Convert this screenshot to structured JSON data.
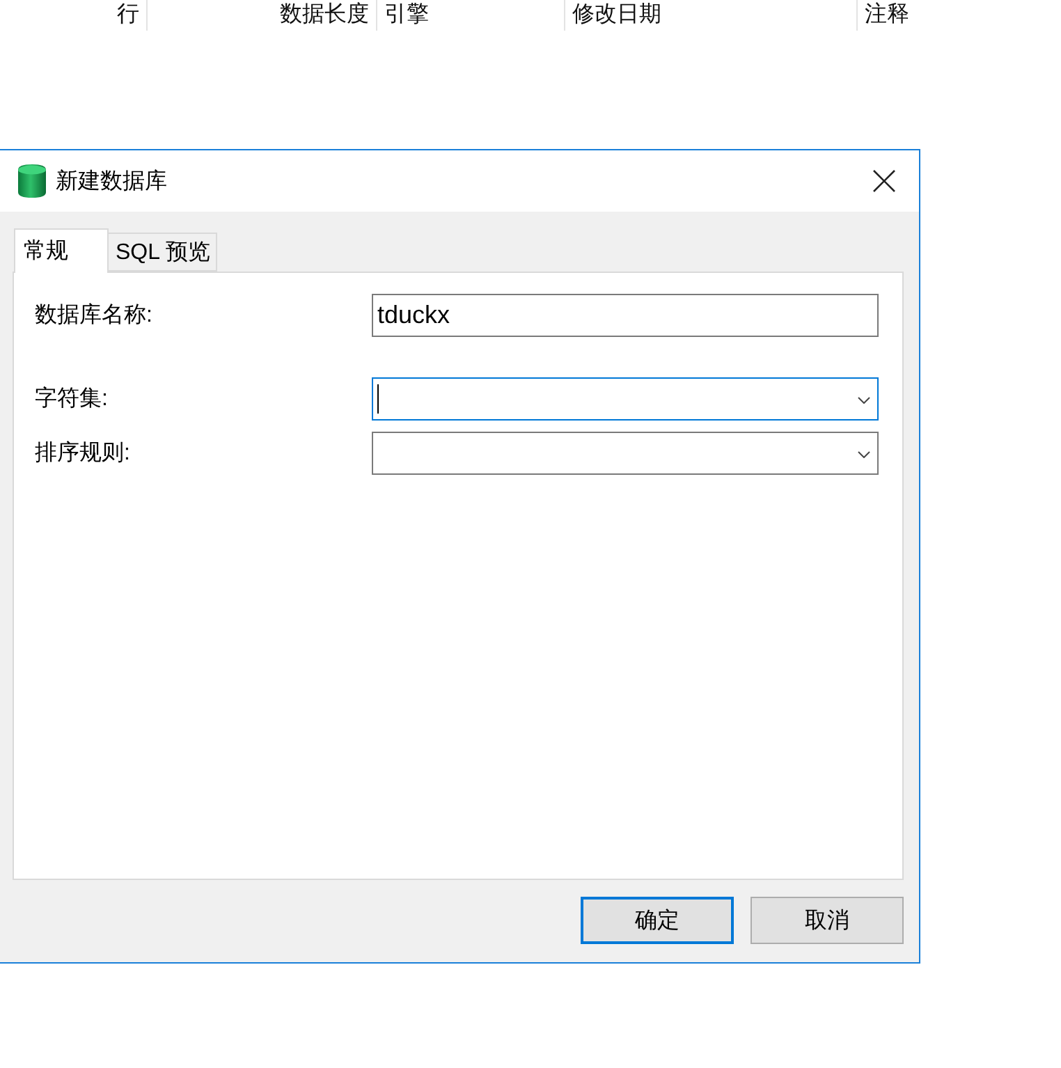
{
  "background_table": {
    "columns": [
      {
        "label": "行",
        "kind": "numeric"
      },
      {
        "label": "数据长度",
        "kind": "numeric"
      },
      {
        "label": "引擎",
        "kind": "text"
      },
      {
        "label": "修改日期",
        "kind": "text"
      },
      {
        "label": "注释",
        "kind": "text"
      }
    ]
  },
  "dialog": {
    "title": "新建数据库",
    "tabs": [
      {
        "label": "常规",
        "selected": true
      },
      {
        "label": "SQL 预览",
        "selected": false
      }
    ],
    "fields": [
      {
        "kind": "text",
        "label": "数据库名称:",
        "value": "tduckx",
        "focused": false
      },
      {
        "kind": "select",
        "label": "字符集:",
        "focused": true
      },
      {
        "kind": "select",
        "label": "排序规则:",
        "focused": false
      }
    ],
    "buttons": [
      {
        "label": "确定",
        "default": true
      },
      {
        "label": "取消",
        "default": false
      }
    ]
  }
}
